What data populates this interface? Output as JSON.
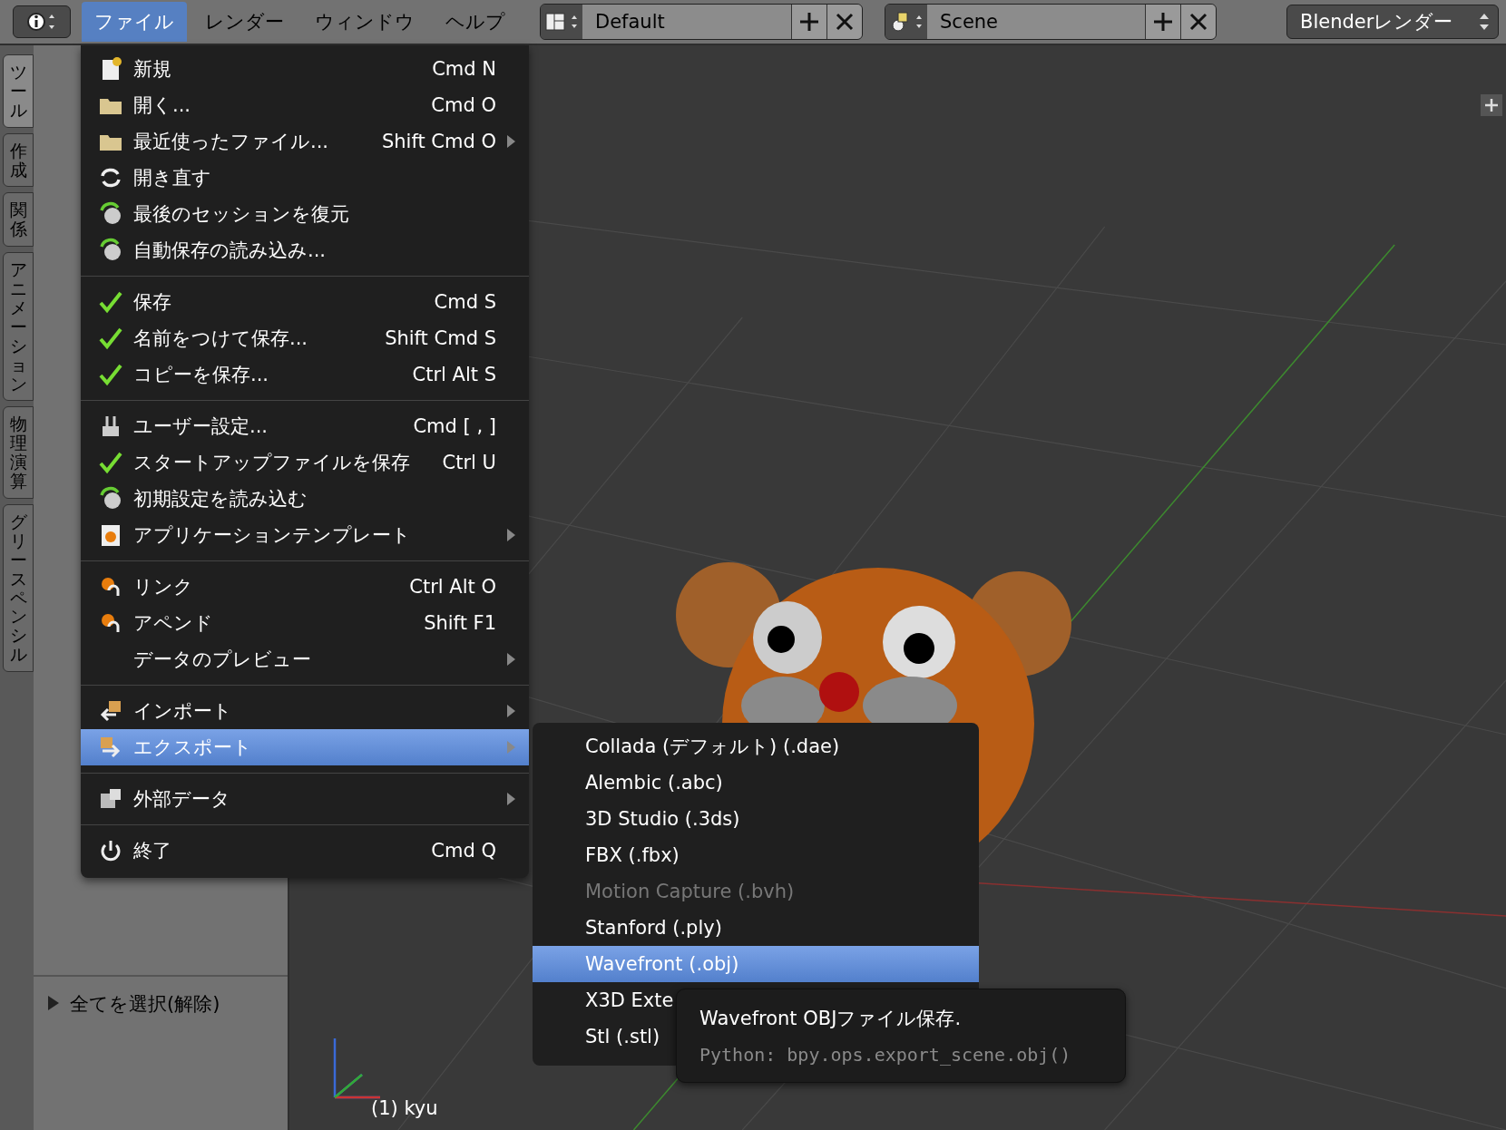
{
  "header": {
    "menus": [
      {
        "label": "ファイル",
        "selected": true
      },
      {
        "label": "レンダー",
        "selected": false
      },
      {
        "label": "ウィンドウ",
        "selected": false
      },
      {
        "label": "ヘルプ",
        "selected": false
      }
    ],
    "layout": {
      "value": "Default"
    },
    "scene": {
      "value": "Scene"
    },
    "engine": {
      "value": "Blenderレンダー"
    }
  },
  "tool_tabs": [
    {
      "label": "ツール",
      "selected": true
    },
    {
      "label": "作成",
      "selected": false
    },
    {
      "label": "関係",
      "selected": false
    },
    {
      "label": "アニメーション",
      "selected": false
    },
    {
      "label": "物理演算",
      "selected": false
    },
    {
      "label": "グリースペンシル",
      "selected": false
    }
  ],
  "operator_panel": {
    "title": "全てを選択(解除)"
  },
  "viewport": {
    "frame_label": "(1) kyu"
  },
  "file_menu": {
    "sections": [
      [
        {
          "label": "新規",
          "shortcut": "Cmd N",
          "has_submenu": false,
          "selected": false
        },
        {
          "label": "開く...",
          "shortcut": "Cmd O",
          "has_submenu": false,
          "selected": false
        },
        {
          "label": "最近使ったファイル...",
          "shortcut": "Shift Cmd O",
          "has_submenu": true,
          "selected": false
        },
        {
          "label": "開き直す",
          "has_submenu": false,
          "selected": false
        },
        {
          "label": "最後のセッションを復元",
          "has_submenu": false,
          "selected": false
        },
        {
          "label": "自動保存の読み込み...",
          "has_submenu": false,
          "selected": false
        }
      ],
      [
        {
          "label": "保存",
          "shortcut": "Cmd S",
          "has_submenu": false,
          "selected": false
        },
        {
          "label": "名前をつけて保存...",
          "shortcut": "Shift Cmd S",
          "has_submenu": false,
          "selected": false
        },
        {
          "label": "コピーを保存...",
          "shortcut": "Ctrl Alt S",
          "has_submenu": false,
          "selected": false
        }
      ],
      [
        {
          "label": "ユーザー設定...",
          "shortcut": "Cmd [ , ]",
          "has_submenu": false,
          "selected": false
        },
        {
          "label": "スタートアップファイルを保存",
          "shortcut": "Ctrl U",
          "has_submenu": false,
          "selected": false
        },
        {
          "label": "初期設定を読み込む",
          "has_submenu": false,
          "selected": false
        },
        {
          "label": "アプリケーションテンプレート",
          "has_submenu": true,
          "selected": false
        }
      ],
      [
        {
          "label": "リンク",
          "shortcut": "Ctrl Alt O",
          "has_submenu": false,
          "selected": false
        },
        {
          "label": "アペンド",
          "shortcut": "Shift F1",
          "has_submenu": false,
          "selected": false
        },
        {
          "label": "データのプレビュー",
          "has_submenu": true,
          "selected": false
        }
      ],
      [
        {
          "label": "インポート",
          "has_submenu": true,
          "selected": false
        },
        {
          "label": "エクスポート",
          "has_submenu": true,
          "selected": true
        }
      ],
      [
        {
          "label": "外部データ",
          "has_submenu": true,
          "selected": false
        }
      ],
      [
        {
          "label": "終了",
          "shortcut": "Cmd Q",
          "has_submenu": false,
          "selected": false
        }
      ]
    ]
  },
  "export_menu": {
    "items": [
      {
        "label": "Collada (デフォルト) (.dae)",
        "disabled": false,
        "selected": false
      },
      {
        "label": "Alembic (.abc)",
        "disabled": false,
        "selected": false
      },
      {
        "label": "3D Studio (.3ds)",
        "disabled": false,
        "selected": false
      },
      {
        "label": "FBX (.fbx)",
        "disabled": false,
        "selected": false
      },
      {
        "label": "Motion Capture (.bvh)",
        "disabled": true,
        "selected": false
      },
      {
        "label": "Stanford (.ply)",
        "disabled": false,
        "selected": false
      },
      {
        "label": "Wavefront (.obj)",
        "disabled": false,
        "selected": true
      },
      {
        "label": "X3D Exte",
        "disabled": false,
        "selected": false
      },
      {
        "label": "Stl (.stl)",
        "disabled": false,
        "selected": false
      }
    ]
  },
  "tooltip": {
    "title": "Wavefront OBJファイル保存.",
    "python": "Python: bpy.ops.export_scene.obj()"
  }
}
